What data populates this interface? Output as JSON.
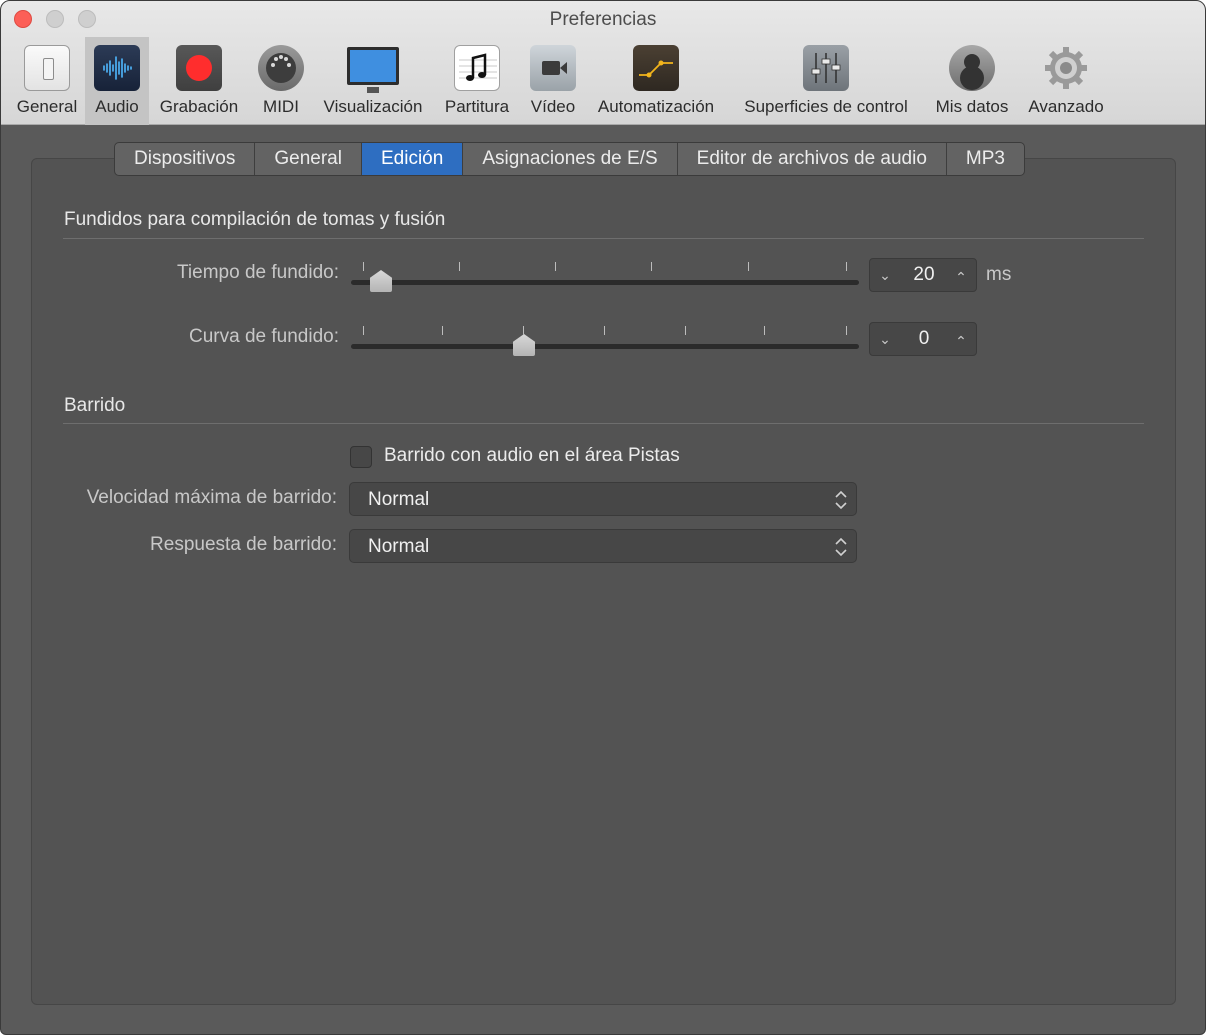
{
  "window": {
    "title": "Preferencias"
  },
  "toolbar": {
    "items": [
      {
        "label": "General",
        "icon": "general-switch-icon"
      },
      {
        "label": "Audio",
        "icon": "audio-waveform-icon",
        "selected": true
      },
      {
        "label": "Grabación",
        "icon": "record-icon"
      },
      {
        "label": "MIDI",
        "icon": "midi-connector-icon"
      },
      {
        "label": "Visualización",
        "icon": "display-monitor-icon"
      },
      {
        "label": "Partitura",
        "icon": "music-note-icon"
      },
      {
        "label": "Vídeo",
        "icon": "video-camera-icon"
      },
      {
        "label": "Automatización",
        "icon": "automation-curve-icon"
      },
      {
        "label": "Superficies de control",
        "icon": "fader-icon"
      },
      {
        "label": "Mis datos",
        "icon": "user-silhouette-icon"
      },
      {
        "label": "Avanzado",
        "icon": "gear-icon"
      }
    ]
  },
  "tabs": [
    {
      "label": "Dispositivos"
    },
    {
      "label": "General"
    },
    {
      "label": "Edición",
      "active": true
    },
    {
      "label": "Asignaciones de E/S"
    },
    {
      "label": "Editor de archivos de audio"
    },
    {
      "label": "MP3"
    }
  ],
  "fades": {
    "section_title": "Fundidos para compilación de tomas y fusión",
    "fade_time": {
      "label": "Tiempo de fundido:",
      "value": "20",
      "unit": "ms",
      "slider_fraction": 0.06
    },
    "fade_curve": {
      "label": "Curva de fundido:",
      "value": "0",
      "slider_fraction": 0.34
    }
  },
  "scrub": {
    "section_title": "Barrido",
    "checkbox": {
      "label": "Barrido con audio en el área Pistas",
      "checked": false
    },
    "max_speed": {
      "label": "Velocidad máxima de barrido:",
      "value": "Normal"
    },
    "response": {
      "label": "Respuesta de barrido:",
      "value": "Normal"
    }
  },
  "colors": {
    "accent": "#2e6ec1",
    "record": "#ff2d2d",
    "close": "#fc5f57"
  }
}
